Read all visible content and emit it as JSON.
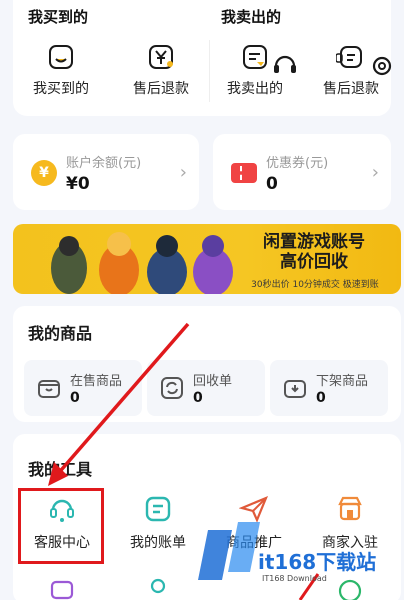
{
  "orders": {
    "buy_title": "我买到的",
    "sell_title": "我卖出的",
    "items": [
      {
        "label": "我买到的",
        "icon": "bag-smile-icon"
      },
      {
        "label": "售后退款",
        "icon": "yen-refund-icon"
      },
      {
        "label": "我卖出的",
        "icon": "sell-chat-icon"
      },
      {
        "label": "售后退款",
        "icon": "sell-refund-icon"
      }
    ],
    "floating_icons": [
      "headset-icon",
      "gear-icon"
    ]
  },
  "balance": {
    "account_title": "账户余额(元)",
    "account_value": "¥0",
    "coin_glyph": "¥",
    "coupon_title": "优惠券(元)",
    "coupon_value": "0"
  },
  "banner": {
    "title_line1": "闲置游戏账号",
    "title_line2": "高价回收",
    "subtitle": "30秒出价 10分钟成交 极速到账"
  },
  "goods": {
    "title": "我的商品",
    "tiles": [
      {
        "label": "在售商品",
        "value": "0",
        "icon": "store-box-icon"
      },
      {
        "label": "回收单",
        "value": "0",
        "icon": "recycle-icon"
      },
      {
        "label": "下架商品",
        "value": "0",
        "icon": "unlisted-box-icon"
      }
    ]
  },
  "tools": {
    "title": "我的工具",
    "items": [
      {
        "label": "客服中心",
        "icon": "headset-icon"
      },
      {
        "label": "我的账单",
        "icon": "bill-icon"
      },
      {
        "label": "商品推广",
        "icon": "paper-plane-icon"
      },
      {
        "label": "商家入驻",
        "icon": "shop-icon"
      }
    ]
  },
  "watermark": {
    "text": "it168下载站",
    "sub": "IT168 Download"
  },
  "colors": {
    "accent_teal": "#2bb7b0",
    "highlight_red": "#e0191c",
    "banner_yellow": "#f3c21d"
  }
}
